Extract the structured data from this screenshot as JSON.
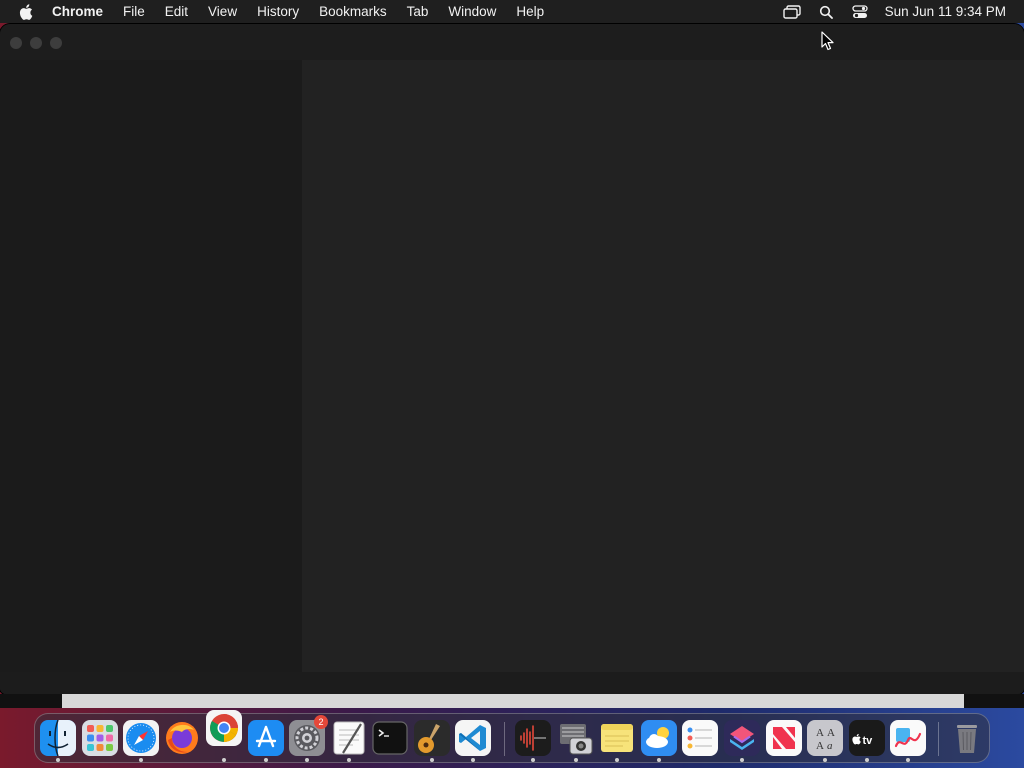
{
  "menubar": {
    "app_name": "Chrome",
    "items": [
      "File",
      "Edit",
      "View",
      "History",
      "Bookmarks",
      "Tab",
      "Window",
      "Help"
    ],
    "clock": "Sun Jun 11  9:34 PM"
  },
  "dock": {
    "apps": [
      {
        "name": "Finder",
        "running": true
      },
      {
        "name": "Launchpad",
        "running": false
      },
      {
        "name": "Safari",
        "running": true
      },
      {
        "name": "Firefox",
        "running": false
      },
      {
        "name": "Google Chrome",
        "running": true
      },
      {
        "name": "App Store",
        "running": true
      },
      {
        "name": "System Settings",
        "running": true,
        "badge": "2"
      },
      {
        "name": "TextEdit",
        "running": true
      },
      {
        "name": "Terminal",
        "running": false
      },
      {
        "name": "GarageBand",
        "running": true
      },
      {
        "name": "Visual Studio Code",
        "running": true
      },
      {
        "name": "Voice Memos",
        "running": true
      },
      {
        "name": "Screenshot",
        "running": true
      },
      {
        "name": "Stickies",
        "running": true
      },
      {
        "name": "Weather",
        "running": true
      },
      {
        "name": "Reminders",
        "running": false
      },
      {
        "name": "Shortcuts",
        "running": true
      },
      {
        "name": "News",
        "running": false
      },
      {
        "name": "Font Book",
        "running": true
      },
      {
        "name": "TV",
        "running": true
      },
      {
        "name": "Freeform",
        "running": true
      },
      {
        "name": "Trash",
        "running": false
      }
    ]
  },
  "colors": {
    "menubar_bg": "#1f1f1f",
    "window_bg": "#1e1e1e",
    "sidebar_bg": "#1b1b1b",
    "content_bg": "#222222"
  }
}
